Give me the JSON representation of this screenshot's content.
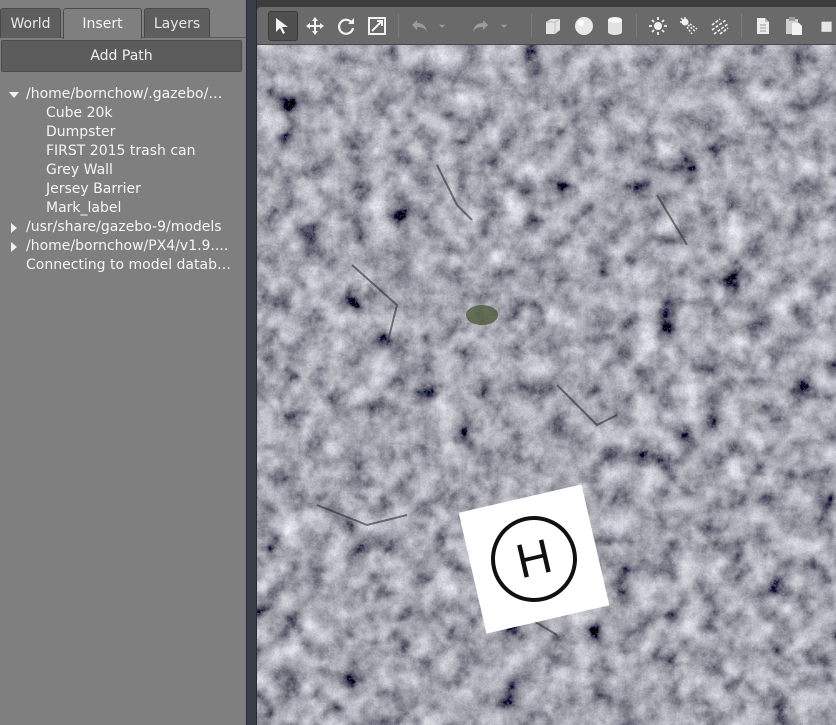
{
  "tabs": {
    "world": "World",
    "insert": "Insert",
    "layers": "Layers"
  },
  "left_panel": {
    "add_path_label": "Add Path",
    "tree": [
      {
        "label": "/home/bornchow/.gazebo/m...",
        "expanded": true
      },
      {
        "label": "Cube 20k"
      },
      {
        "label": "Dumpster"
      },
      {
        "label": "FIRST 2015 trash can"
      },
      {
        "label": "Grey Wall"
      },
      {
        "label": "Jersey Barrier"
      },
      {
        "label": "Mark_label"
      },
      {
        "label": "/usr/share/gazebo-9/models",
        "expanded": false
      },
      {
        "label": "/home/bornchow/PX4/v1.9....",
        "expanded": false
      },
      {
        "label": "Connecting to model databa..."
      }
    ]
  },
  "toolbar": {
    "tools": [
      "select-arrow-icon",
      "translate-icon",
      "rotate-icon",
      "scale-icon",
      "undo-icon",
      "redo-icon",
      "box-shape-icon",
      "sphere-shape-icon",
      "cylinder-shape-icon",
      "point-light-icon",
      "spot-light-icon",
      "directional-light-icon",
      "copy-icon",
      "paste-icon"
    ]
  },
  "viewport": {
    "marker_letter": "H",
    "ground": "asphalt-texture"
  }
}
